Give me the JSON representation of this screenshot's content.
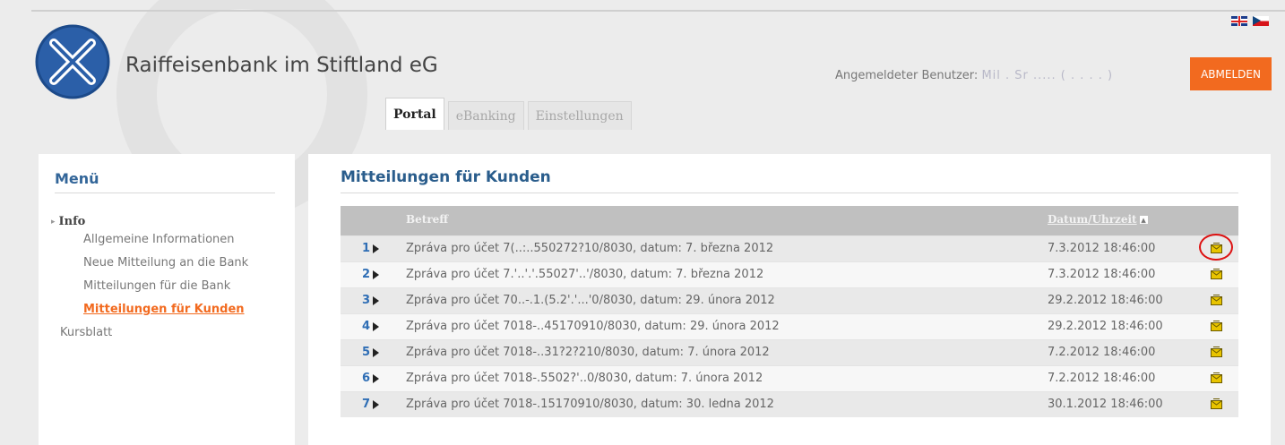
{
  "header": {
    "bank_name": "Raiffeisenbank im Stiftland eG",
    "user_label": "Angemeldeter Benutzer:",
    "user_value": "Mil . Sr ..... ( . . . . )",
    "logout_label": "ABMELDEN",
    "flags": [
      "uk-flag-icon",
      "cz-flag-icon"
    ]
  },
  "tabs": [
    {
      "label": "Portal",
      "active": true
    },
    {
      "label": "eBanking",
      "active": false
    },
    {
      "label": "Einstellungen",
      "active": false
    }
  ],
  "menu": {
    "title": "Menü",
    "group_label": "Info",
    "items": [
      {
        "label": "Allgemeine Informationen",
        "active": false
      },
      {
        "label": "Neue Mitteilung an die Bank",
        "active": false
      },
      {
        "label": "Mitteilungen für die Bank",
        "active": false
      },
      {
        "label": "Mitteilungen für Kunden",
        "active": true
      }
    ],
    "extra_label": "Kursblatt"
  },
  "content": {
    "title": "Mitteilungen für Kunden",
    "columns": {
      "betreff": "Betreff",
      "datum": "Datum/Uhrzeit"
    },
    "rows": [
      {
        "num": "1",
        "subject": "Zpráva pro účet 7(..:..550272?10/8030, datum: 7. března 2012",
        "date": "7.3.2012 18:46:00"
      },
      {
        "num": "2",
        "subject": "Zpráva pro účet 7.'..'.'.55027'..'/8030, datum: 7. března 2012",
        "date": "7.3.2012 18:46:00"
      },
      {
        "num": "3",
        "subject": "Zpráva pro účet 70..-.1.(5.2'.'...'0/8030, datum: 29. února 2012",
        "date": "29.2.2012 18:46:00"
      },
      {
        "num": "4",
        "subject": "Zpráva pro účet 7018-..45170910/8030, datum: 29. února 2012",
        "date": "29.2.2012 18:46:00"
      },
      {
        "num": "5",
        "subject": "Zpráva pro účet 7018-..31?2?210/8030, datum: 7. února 2012",
        "date": "7.2.2012 18:46:00"
      },
      {
        "num": "6",
        "subject": "Zpráva pro účet 7018-.5502?'..0/8030, datum: 7. února 2012",
        "date": "7.2.2012 18:46:00"
      },
      {
        "num": "7",
        "subject": "Zpráva pro účet 7018-.15170910/8030, datum: 30. ledna 2012",
        "date": "30.1.2012 18:46:00"
      }
    ]
  }
}
